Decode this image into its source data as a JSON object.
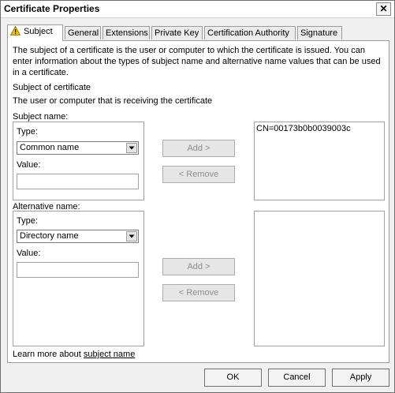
{
  "window": {
    "title": "Certificate Properties",
    "close_glyph": "✕"
  },
  "tabs": [
    {
      "label": "Subject",
      "icon": "warning-icon"
    },
    {
      "label": "General"
    },
    {
      "label": "Extensions"
    },
    {
      "label": "Private Key"
    },
    {
      "label": "Certification Authority"
    },
    {
      "label": "Signature"
    }
  ],
  "subject": {
    "intro": "The subject of a certificate is the user or computer to which the certificate is issued. You can enter information about the types of subject name and alternative name values that can be used in a certificate.",
    "section_title": "Subject of certificate",
    "section_desc": "The user or computer that is receiving the certificate",
    "subject_name": {
      "label": "Subject name:",
      "type_label": "Type:",
      "type_value": "Common name",
      "value_label": "Value:",
      "value": "",
      "add_label": "Add >",
      "remove_label": "< Remove",
      "entries": [
        "CN=00173b0b0039003c"
      ]
    },
    "alternative_name": {
      "label": "Alternative name:",
      "type_label": "Type:",
      "type_value": "Directory name",
      "value_label": "Value:",
      "value": "",
      "add_label": "Add >",
      "remove_label": "< Remove",
      "entries": []
    },
    "learn_more_prefix": "Learn more about ",
    "learn_more_link": "subject name"
  },
  "buttons": {
    "ok": "OK",
    "cancel": "Cancel",
    "apply": "Apply"
  },
  "colors": {
    "disabled_text": "#8d8d8d",
    "warning": "#f2c200"
  }
}
